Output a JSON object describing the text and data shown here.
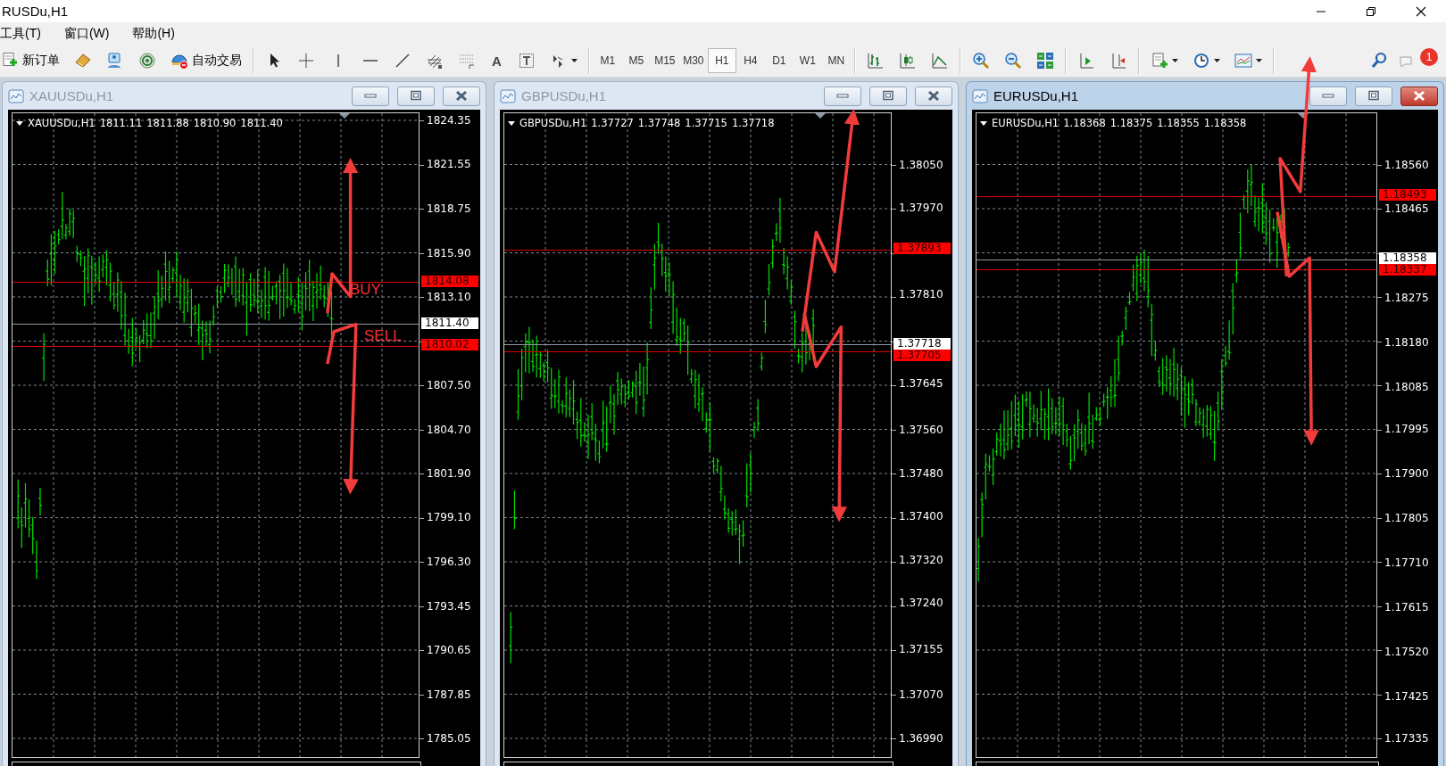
{
  "window": {
    "title": "RUSDu,H1"
  },
  "menu": [
    {
      "label": "工具(T)"
    },
    {
      "label": "窗口(W)"
    },
    {
      "label": "帮助(H)"
    }
  ],
  "toolbar": {
    "new_order": "新订单",
    "auto_trading": "自动交易",
    "text_tool": "A",
    "timeframes": [
      {
        "label": "M1",
        "selected": false
      },
      {
        "label": "M5",
        "selected": false
      },
      {
        "label": "M15",
        "selected": false
      },
      {
        "label": "M30",
        "selected": false
      },
      {
        "label": "H1",
        "selected": true
      },
      {
        "label": "H4",
        "selected": false
      },
      {
        "label": "D1",
        "selected": false
      },
      {
        "label": "W1",
        "selected": false
      },
      {
        "label": "MN",
        "selected": false
      }
    ],
    "notifications": "1"
  },
  "charts": [
    {
      "title": "XAUUSDu,H1",
      "active": false,
      "symbol": "XAUUSDu,H1",
      "quotes": [
        "1811.11",
        "1811.88",
        "1810.90",
        "1811.40"
      ],
      "price_axis": [
        "1824.35",
        "1821.55",
        "1818.75",
        "1815.90",
        "1813.10",
        "1807.50",
        "1804.70",
        "1801.90",
        "1799.10",
        "1796.30",
        "1793.45",
        "1790.65",
        "1787.85",
        "1785.05"
      ],
      "price_lines": [
        {
          "kind": "order",
          "label": "1814.08"
        },
        {
          "kind": "bid",
          "label": "1811.40"
        },
        {
          "kind": "order",
          "label": "1810.02"
        }
      ],
      "notes": [
        {
          "text": "BUY"
        },
        {
          "text": "SELL"
        }
      ]
    },
    {
      "title": "GBPUSDu,H1",
      "active": false,
      "symbol": "GBPUSDu,H1",
      "quotes": [
        "1.37727",
        "1.37748",
        "1.37715",
        "1.37718"
      ],
      "price_axis": [
        "1.38050",
        "1.37970",
        "1.37810",
        "1.37645",
        "1.37560",
        "1.37480",
        "1.37400",
        "1.37320",
        "1.37240",
        "1.37155",
        "1.37070",
        "1.36990"
      ],
      "price_lines": [
        {
          "kind": "order",
          "label": "1.37893"
        },
        {
          "kind": "bid",
          "label": "1.37718"
        },
        {
          "kind": "order",
          "label": "1.37705"
        }
      ]
    },
    {
      "title": "EURUSDu,H1",
      "active": true,
      "symbol": "EURUSDu,H1",
      "quotes": [
        "1.18368",
        "1.18375",
        "1.18355",
        "1.18358"
      ],
      "price_axis": [
        "1.18560",
        "1.18465",
        "1.18275",
        "1.18180",
        "1.18085",
        "1.17995",
        "1.17900",
        "1.17805",
        "1.17710",
        "1.17615",
        "1.17520",
        "1.17425",
        "1.17335"
      ],
      "price_lines": [
        {
          "kind": "order",
          "label": "1.18493"
        },
        {
          "kind": "bid",
          "label": "1.18358"
        },
        {
          "kind": "order",
          "label": "1.18337"
        }
      ]
    }
  ]
}
